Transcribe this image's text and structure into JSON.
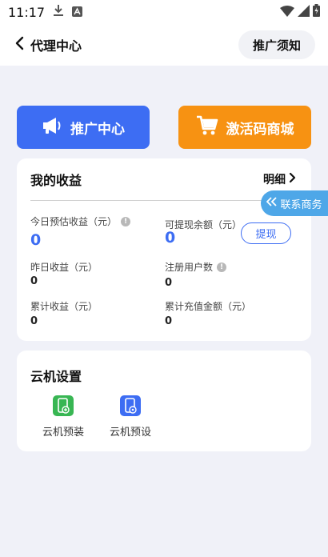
{
  "status_bar": {
    "time": "11:17"
  },
  "header": {
    "title": "代理中心",
    "notice_button": "推广须知"
  },
  "actions": {
    "promo_label": "推广中心",
    "mall_label": "激活码商城"
  },
  "earnings": {
    "title": "我的收益",
    "detail_link": "明细",
    "today_estimate_label": "今日预估收益（元）",
    "today_estimate_value": "0",
    "withdrawable_label": "可提现余额（元）",
    "withdrawable_value": "0",
    "withdraw_button": "提现",
    "yesterday_label": "昨日收益（元）",
    "yesterday_value": "0",
    "registered_users_label": "注册用户数",
    "registered_users_value": "0",
    "cumulative_label": "累计收益（元）",
    "cumulative_value": "0",
    "cumulative_recharge_label": "累计充值金额（元）",
    "cumulative_recharge_value": "0"
  },
  "contact": {
    "label": "联系商务"
  },
  "cloud_settings": {
    "title": "云机设置",
    "items": [
      {
        "label": "云机预装",
        "icon": "phone-install-icon",
        "color": "#38b653"
      },
      {
        "label": "云机预设",
        "icon": "phone-preset-icon",
        "color": "#3d6df3"
      }
    ]
  },
  "colors": {
    "primary": "#3d6df3",
    "orange": "#f79212",
    "contact": "#4ea7e8",
    "background": "#f0f1f8"
  }
}
